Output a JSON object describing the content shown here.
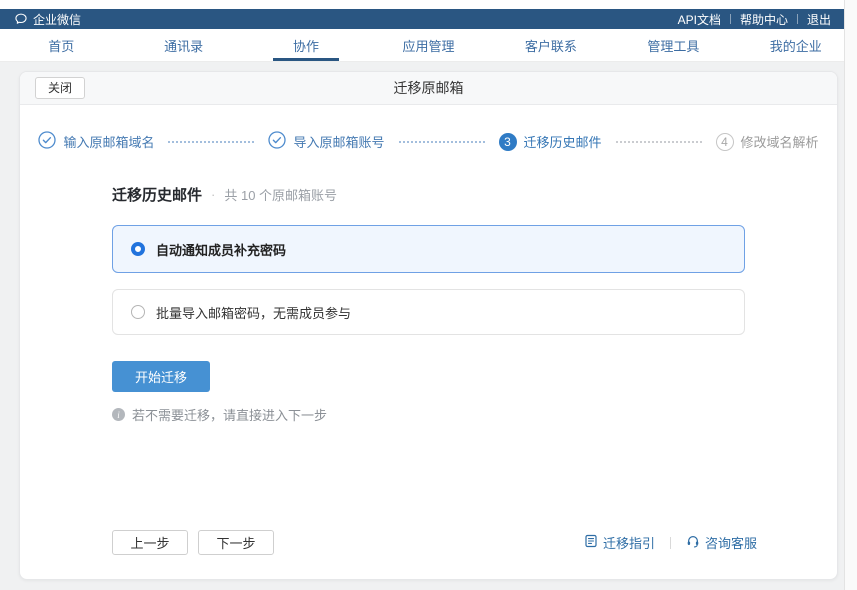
{
  "topbar": {
    "brand": "企业微信",
    "links": [
      {
        "label": "API文档"
      },
      {
        "label": "帮助中心"
      },
      {
        "label": "退出"
      }
    ]
  },
  "nav": {
    "items": [
      {
        "label": "首页",
        "active": false
      },
      {
        "label": "通讯录",
        "active": false
      },
      {
        "label": "协作",
        "active": true
      },
      {
        "label": "应用管理",
        "active": false
      },
      {
        "label": "客户联系",
        "active": false
      },
      {
        "label": "管理工具",
        "active": false
      },
      {
        "label": "我的企业",
        "active": false
      }
    ]
  },
  "wizard": {
    "close_label": "关闭",
    "title": "迁移原邮箱",
    "steps": [
      {
        "label": "输入原邮箱域名",
        "status": "done"
      },
      {
        "label": "导入原邮箱账号",
        "status": "done"
      },
      {
        "number": "3",
        "label": "迁移历史邮件",
        "status": "current"
      },
      {
        "number": "4",
        "label": "修改域名解析",
        "status": "pending"
      }
    ]
  },
  "main": {
    "heading": "迁移历史邮件",
    "separator": "·",
    "subtitle": "共 10 个原邮箱账号",
    "options": [
      {
        "label": "自动通知成员补充密码",
        "selected": true
      },
      {
        "label": "批量导入邮箱密码，无需成员参与",
        "selected": false
      }
    ],
    "start_button": "开始迁移",
    "hint_icon_glyph": "i",
    "hint": "若不需要迁移，请直接进入下一步"
  },
  "footer": {
    "prev_button": "上一步",
    "next_button": "下一步",
    "guide_link": "迁移指引",
    "support_link": "咨询客服"
  },
  "icons": {
    "brand": "chat-bubble",
    "step_done": "check-circle",
    "hint": "info-circle",
    "guide": "document-lines",
    "support": "headset"
  },
  "colors": {
    "topbar_bg": "#2a5682",
    "nav_link": "#3d6da3",
    "nav_active_underline": "#2a5682",
    "page_bg": "#f0f1f2",
    "accent_button": "#4691d3",
    "radio_selected": "#2173dd",
    "selected_option_bg": "#f0f6fe",
    "selected_option_border": "#6fa1e5",
    "step_done": "#4e8bcd",
    "step_current_bg": "#2f7bc5",
    "footer_link": "#2e6da5"
  }
}
